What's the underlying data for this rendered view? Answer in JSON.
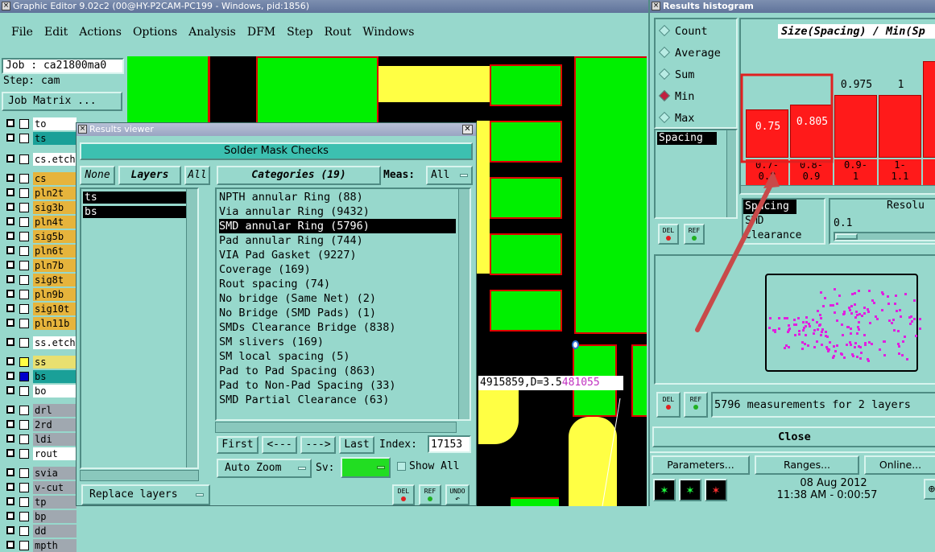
{
  "main_window": {
    "title": "Graphic Editor 9.02c2 (00@HY-P2CAM-PC199 - Windows, pid:1856)",
    "menu": [
      "File",
      "Edit",
      "Actions",
      "Options",
      "Analysis",
      "DFM",
      "Step",
      "Rout",
      "Windows"
    ]
  },
  "job": {
    "job_label": "Job : ca21800ma0",
    "step_label": "Step: cam",
    "matrix_button": "Job Matrix ..."
  },
  "layers": [
    {
      "name": "to",
      "color": "#ffffff"
    },
    {
      "name": "ts",
      "color": "#1aa098"
    },
    {
      "name": "cs.etch",
      "color": "#ffffff"
    },
    {
      "name": "cs",
      "color": "#e6b43c"
    },
    {
      "name": "pln2t",
      "color": "#e6b43c"
    },
    {
      "name": "sig3b",
      "color": "#e6b43c"
    },
    {
      "name": "pln4t",
      "color": "#e6b43c"
    },
    {
      "name": "sig5b",
      "color": "#e6b43c"
    },
    {
      "name": "pln6t",
      "color": "#e6b43c"
    },
    {
      "name": "pln7b",
      "color": "#e6b43c"
    },
    {
      "name": "sig8t",
      "color": "#e6b43c"
    },
    {
      "name": "pln9b",
      "color": "#e6b43c"
    },
    {
      "name": "sig10t",
      "color": "#e6b43c"
    },
    {
      "name": "pln11b",
      "color": "#e6b43c"
    },
    {
      "name": "ss.etch",
      "color": "#ffffff"
    },
    {
      "name": "ss",
      "color": "#e8e070"
    },
    {
      "name": "bs",
      "color": "#1aa098"
    },
    {
      "name": "bo",
      "color": "#ffffff"
    },
    {
      "name": "drl",
      "color": "#a0a8b0"
    },
    {
      "name": "2rd",
      "color": "#a0a8b0"
    },
    {
      "name": "ldi",
      "color": "#a0a8b0"
    },
    {
      "name": "rout",
      "color": "#ffffff"
    },
    {
      "name": "svia",
      "color": "#a0a8b0"
    },
    {
      "name": "v-cut",
      "color": "#a0a8b0"
    },
    {
      "name": "tp",
      "color": "#a0a8b0"
    },
    {
      "name": "bp",
      "color": "#a0a8b0"
    },
    {
      "name": "dd",
      "color": "#a0a8b0"
    },
    {
      "name": "mpth",
      "color": "#a0a8b0"
    }
  ],
  "results_viewer": {
    "title": "Results viewer",
    "header": "Solder Mask Checks",
    "none_btn": "None",
    "layers_btn": "Layers",
    "all_btn": "All",
    "layer_list": [
      "ts",
      "bs"
    ],
    "categories_btn": "Categories (19)",
    "meas_label": "Meas:",
    "meas_value": "All",
    "categories": [
      "NPTH annular Ring (88)",
      "Via annular Ring (9432)",
      "SMD annular Ring (5796)",
      "Pad annular Ring (744)",
      "VIA Pad Gasket (9227)",
      "Coverage (169)",
      "Rout spacing (74)",
      "No bridge (Same Net) (2)",
      "No Bridge (SMD Pads) (1)",
      "SMDs Clearance Bridge (838)",
      "SM slivers (169)",
      "SM local spacing (5)",
      "Pad to Pad Spacing (863)",
      "Pad to Non-Pad Spacing (33)",
      "SMD Partial Clearance (63)"
    ],
    "selected_index": 2,
    "first_btn": "First",
    "prev_btn": "<---",
    "next_btn": "--->",
    "last_btn": "Last",
    "index_label": "Index:",
    "index_value": "17153",
    "autozoom_label": "Auto Zoom",
    "sv_label": "Sv:",
    "show_all_label": "Show All",
    "replace_layers_label": "Replace layers",
    "del_label": "DEL",
    "ref_label": "REF",
    "undo_label": "UNDO"
  },
  "canvas": {
    "coord_text": "4915859,D=3.5",
    "coord_hl": "481055"
  },
  "histogram": {
    "title": "Results histogram",
    "options": [
      {
        "label": "Count",
        "selected": false
      },
      {
        "label": "Average",
        "selected": false
      },
      {
        "label": "Sum",
        "selected": false
      },
      {
        "label": "Min",
        "selected": true
      },
      {
        "label": "Max",
        "selected": false
      }
    ],
    "chart_title": "Size(Spacing) / Min(Sp",
    "bars": [
      {
        "value": "0.75",
        "range_top": "0.7-",
        "range_bottom": "0.8",
        "h": 0.5
      },
      {
        "value": "0.805",
        "range_top": "0.8-",
        "range_bottom": "0.9",
        "h": 0.55
      },
      {
        "value": "0.975",
        "range_top": "0.9-",
        "range_bottom": "1",
        "h": 0.65
      },
      {
        "value": "1",
        "range_top": "1-",
        "range_bottom": "1.1",
        "h": 0.65
      },
      {
        "value": "1.",
        "range_top": "1",
        "range_bottom": "",
        "h": 1.0
      }
    ],
    "meas_list": [
      "Spacing"
    ],
    "meas_list2": [
      "Spacing",
      "SMD",
      "Clearance"
    ],
    "resolution_label": "Resolu",
    "resolution_value": "0.1",
    "status": "5796 measurements for 2 layers",
    "close_btn": "Close"
  },
  "bottom": {
    "parameters_btn": "Parameters...",
    "ranges_btn": "Ranges...",
    "online_btn": "Online...",
    "date": "08 Aug 2012",
    "time": "11:38 AM - 0:00:57"
  }
}
